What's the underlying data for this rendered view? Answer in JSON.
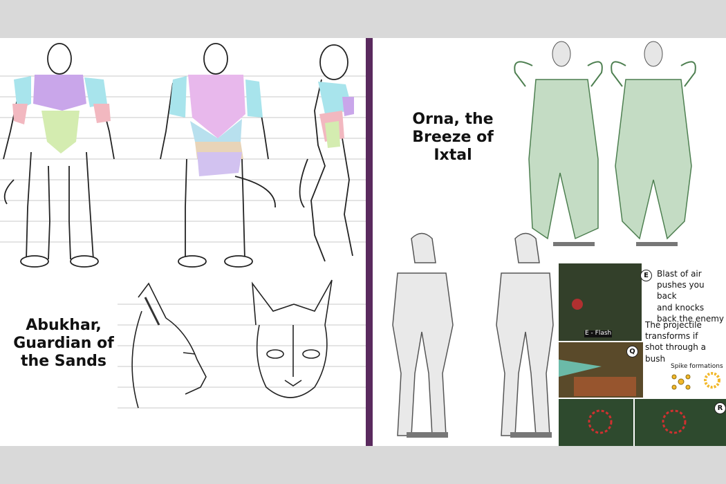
{
  "left_character": {
    "name_line1": "Abukhar,",
    "name_line2": "Guardian of",
    "name_line3": "the Sands"
  },
  "right_character": {
    "name_line1": "Orna, the",
    "name_line2": "Breeze of Ixtal"
  },
  "abilities": {
    "e": {
      "key": "E",
      "note_line1": "Blast of air",
      "note_line2": "pushes you back",
      "note_line3": "and knocks",
      "note_line4": "back the enemy",
      "flash_label": "E - Flash"
    },
    "q": {
      "key": "Q",
      "note_line1": "The projectile",
      "note_line2": "transforms if",
      "note_line3": "shot through a",
      "note_line4": "bush",
      "spike_label": "Spike formations"
    },
    "r": {
      "key": "R"
    }
  },
  "colors": {
    "divider": "#5a2a5e",
    "cape_green": "#5e9a62",
    "muscle_purple": "#c9a6ea",
    "muscle_cyan": "#a8e4ec",
    "muscle_green": "#d4ecb0",
    "muscle_pink": "#f2b8c0",
    "muscle_tan": "#e8d4b8"
  }
}
